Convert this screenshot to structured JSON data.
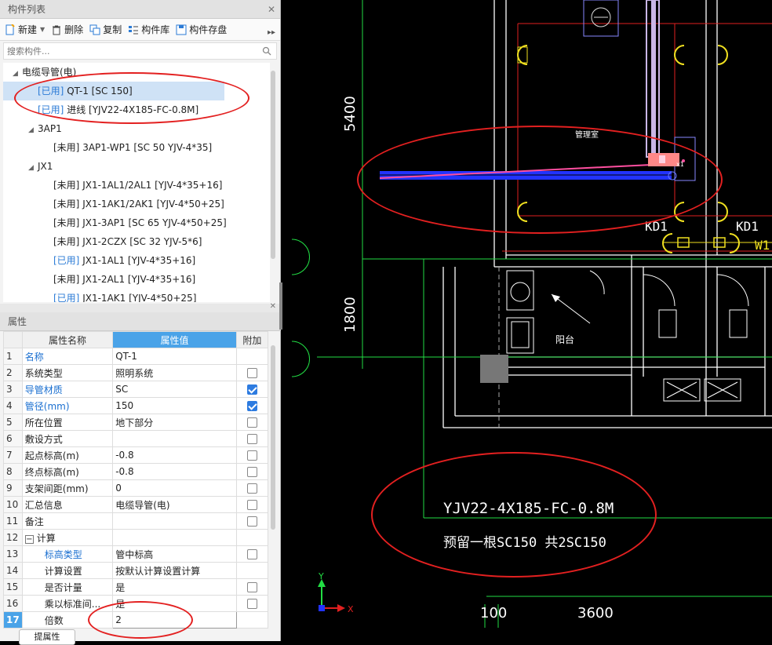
{
  "panel_components": {
    "title": "构件列表"
  },
  "toolbar": {
    "new": "新建",
    "delete": "删除",
    "copy": "复制",
    "library": "构件库",
    "save": "构件存盘"
  },
  "search": {
    "placeholder": "搜索构件..."
  },
  "tree": {
    "root": "电缆导管(电)",
    "items": [
      {
        "status": "[已用]",
        "label": "QT-1 [SC 150]"
      },
      {
        "status": "[已用]",
        "label": "进线 [YJV22-4X185-FC-0.8M]"
      }
    ],
    "group1": "3AP1",
    "group1_items": [
      {
        "status": "[未用]",
        "label": "3AP1-WP1 [SC 50 YJV-4*35]"
      }
    ],
    "group2": "JX1",
    "group2_items": [
      {
        "status": "[未用]",
        "label": "JX1-1AL1/2AL1 [YJV-4*35+16]"
      },
      {
        "status": "[未用]",
        "label": "JX1-1AK1/2AK1 [YJV-4*50+25]"
      },
      {
        "status": "[未用]",
        "label": "JX1-3AP1 [SC 65 YJV-4*50+25]"
      },
      {
        "status": "[未用]",
        "label": "JX1-2CZX [SC 32 YJV-5*6]"
      },
      {
        "status": "[已用]",
        "label": "JX1-1AL1 [YJV-4*35+16]"
      },
      {
        "status": "[未用]",
        "label": "JX1-2AL1 [YJV-4*35+16]"
      },
      {
        "status": "[已用]",
        "label": "JX1-1AK1 [YJV-4*50+25]"
      }
    ]
  },
  "panel_props": {
    "title": "属性"
  },
  "props": {
    "col_name": "属性名称",
    "col_value": "属性值",
    "col_extra": "附加",
    "rows": [
      {
        "n": "1",
        "name": "名称",
        "value": "QT-1"
      },
      {
        "n": "2",
        "name": "系统类型",
        "value": "照明系统"
      },
      {
        "n": "3",
        "name": "导管材质",
        "value": "SC"
      },
      {
        "n": "4",
        "name": "管径(mm)",
        "value": "150"
      },
      {
        "n": "5",
        "name": "所在位置",
        "value": "地下部分"
      },
      {
        "n": "6",
        "name": "敷设方式",
        "value": ""
      },
      {
        "n": "7",
        "name": "起点标高(m)",
        "value": "-0.8"
      },
      {
        "n": "8",
        "name": "终点标高(m)",
        "value": "-0.8"
      },
      {
        "n": "9",
        "name": "支架间距(mm)",
        "value": "0"
      },
      {
        "n": "10",
        "name": "汇总信息",
        "value": "电缆导管(电)"
      },
      {
        "n": "11",
        "name": "备注",
        "value": ""
      },
      {
        "n": "12",
        "name": "计算",
        "value": ""
      },
      {
        "n": "13",
        "name": "标高类型",
        "value": "管中标高"
      },
      {
        "n": "14",
        "name": "计算设置",
        "value": "按默认计算设置计算"
      },
      {
        "n": "15",
        "name": "是否计量",
        "value": "是"
      },
      {
        "n": "16",
        "name": "乘以标准间...",
        "value": "是"
      },
      {
        "n": "17",
        "name": "倍数",
        "value": "2"
      }
    ],
    "expander": "−"
  },
  "bottom_btn": "提属性",
  "cad": {
    "dim_5400": "5400",
    "dim_1800": "1800",
    "dim_100": "100",
    "dim_3600": "3600",
    "room_label": "管理室",
    "balcony_label": "阳台",
    "kd1_left": "KD1",
    "kd1_right": "KD1",
    "w1": "W1",
    "cable_note": "YJV22-4X185-FC-0.8M",
    "conduit_note": "预留一根SC150  共2SC150",
    "axis_x": "X",
    "axis_y": "Y",
    "node_label": "x1",
    "colors": {
      "wall": "#ffffff",
      "grid_green": "#22dd44",
      "red_line": "#e02020",
      "yellow": "#f0e020",
      "conduit_blue": "#2233ff",
      "pink": "#ff4fa0",
      "lilac": "#d9c7ee"
    }
  }
}
